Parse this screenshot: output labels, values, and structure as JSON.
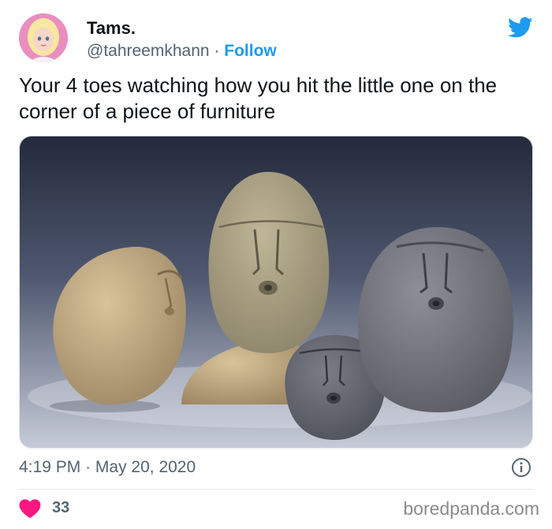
{
  "author": {
    "name": "Tams.",
    "handle": "@tahreemkhann",
    "separator": "·",
    "follow_label": "Follow"
  },
  "tweet": {
    "text": "Your 4 toes watching how you hit the little one on the corner of a piece of furniture"
  },
  "meta": {
    "time": "4:19 PM",
    "separator": "·",
    "date": "May 20, 2020"
  },
  "engagement": {
    "likes": "33"
  },
  "watermark": "boredpanda.com",
  "icons": {
    "logo": "twitter-bird-icon",
    "info": "info-icon",
    "like": "heart-icon"
  },
  "colors": {
    "accent": "#1d9bf0",
    "like": "#f91880",
    "muted": "#536471"
  }
}
